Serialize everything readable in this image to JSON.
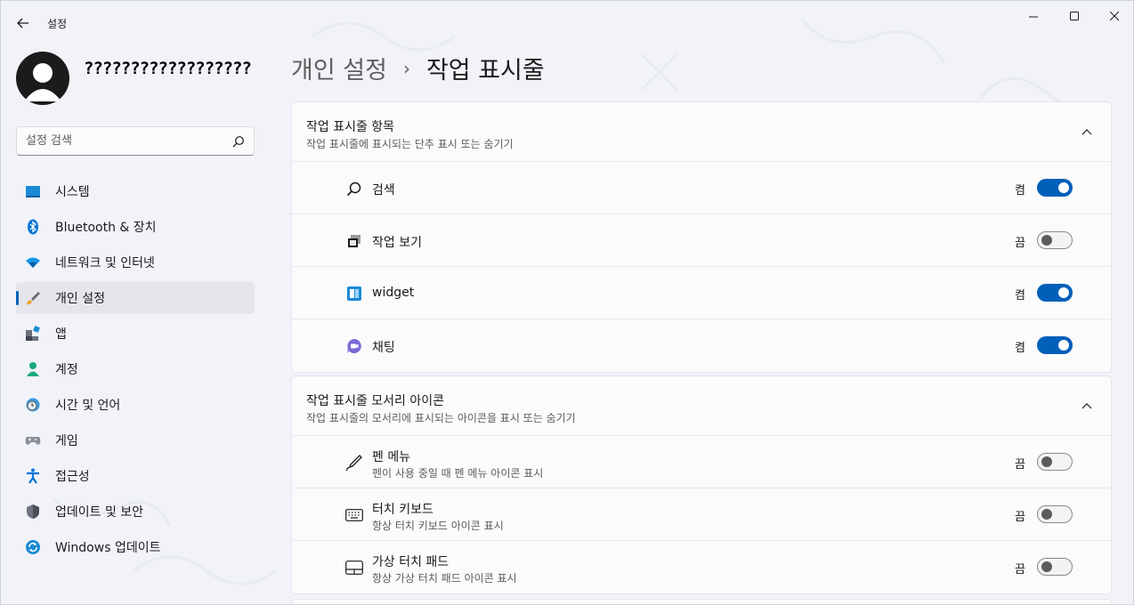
{
  "app": {
    "title": "설정",
    "back_icon": "back-arrow-icon"
  },
  "window_controls": [
    "minimize-icon",
    "maximize-icon",
    "close-icon"
  ],
  "profile": {
    "name": "??????????????????"
  },
  "search": {
    "placeholder": "설정 검색",
    "value": ""
  },
  "sidebar": {
    "items": [
      {
        "label": "시스템",
        "icon": "system-monitor-icon",
        "active": false
      },
      {
        "label": "Bluetooth & 장치",
        "icon": "bluetooth-icon",
        "active": false
      },
      {
        "label": "네트워크 및 인터넷",
        "icon": "wifi-icon",
        "active": false
      },
      {
        "label": "개인 설정",
        "icon": "paintbrush-icon",
        "active": true
      },
      {
        "label": "앱",
        "icon": "apps-icon",
        "active": false
      },
      {
        "label": "계정",
        "icon": "person-icon",
        "active": false
      },
      {
        "label": "시간 및 언어",
        "icon": "clock-globe-icon",
        "active": false
      },
      {
        "label": "게임",
        "icon": "gamepad-icon",
        "active": false
      },
      {
        "label": "접근성",
        "icon": "accessibility-icon",
        "active": false
      },
      {
        "label": "업데이트 및 보안",
        "icon": "shield-icon",
        "active": false
      },
      {
        "label": "Windows 업데이트",
        "icon": "sync-icon",
        "active": false
      }
    ]
  },
  "breadcrumb": {
    "parent": "개인 설정",
    "separator": "›",
    "current": "작업 표시줄"
  },
  "sections": [
    {
      "title": "작업 표시줄 항목",
      "subtitle": "작업 표시줄에 표시되는 단추 표시 또는 숨기기",
      "expanded": true,
      "rows": [
        {
          "label": "검색",
          "sub": "",
          "icon": "search-icon",
          "state": "켬",
          "on": true
        },
        {
          "label": "작업 보기",
          "sub": "",
          "icon": "task-view-icon",
          "state": "끔",
          "on": false
        },
        {
          "label": "widget",
          "sub": "",
          "icon": "widgets-icon",
          "state": "켬",
          "on": true
        },
        {
          "label": "채팅",
          "sub": "",
          "icon": "chat-icon",
          "state": "켬",
          "on": true
        }
      ]
    },
    {
      "title": "작업 표시줄 모서리 아이콘",
      "subtitle": "작업 표시줄의 모서리에 표시되는 아이콘을 표시 또는 숨기기",
      "expanded": true,
      "rows": [
        {
          "label": "펜 메뉴",
          "sub": "펜이 사용 중일 때 펜 메뉴 아이콘 표시",
          "icon": "pen-icon",
          "state": "끔",
          "on": false
        },
        {
          "label": "터치 키보드",
          "sub": "항상 터치 키보드 아이콘 표시",
          "icon": "keyboard-icon",
          "state": "끔",
          "on": false
        },
        {
          "label": "가상 터치 패드",
          "sub": "항상 가상 터치 패드 아이콘 표시",
          "icon": "touchpad-icon",
          "state": "끔",
          "on": false
        }
      ]
    }
  ],
  "colors": {
    "accent": "#005fb8",
    "background": "#f1f3f9",
    "card": "#fbfbfc"
  }
}
